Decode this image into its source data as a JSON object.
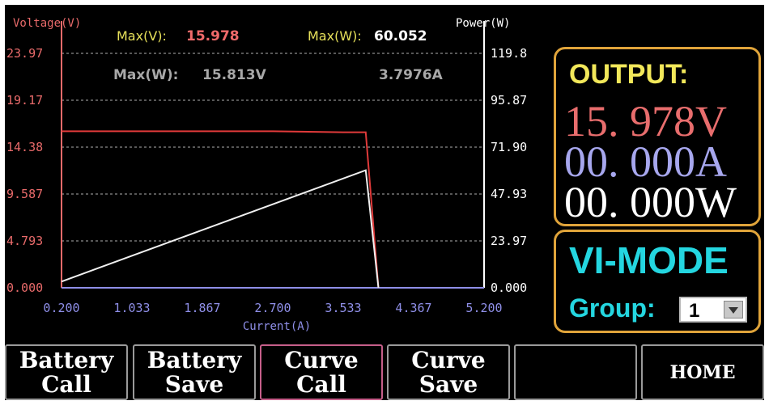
{
  "chart_data": {
    "type": "line",
    "y_axis_label": "Voltage(V)",
    "y2_axis_label": "Power(W)",
    "x_axis_label": "Current(A)",
    "xlim": [
      0.2,
      5.2
    ],
    "ylim": [
      0,
      23.97
    ],
    "y2lim": [
      0,
      119.8
    ],
    "x_ticks": [
      "0.200",
      "1.033",
      "1.867",
      "2.700",
      "3.533",
      "4.367",
      "5.200"
    ],
    "y_ticks": [
      "0.000",
      "4.793",
      "9.587",
      "14.38",
      "19.17",
      "23.97"
    ],
    "y2_ticks": [
      "0.000",
      "23.97",
      "47.93",
      "71.90",
      "95.87",
      "119.8"
    ],
    "max_v_label": "Max(V):",
    "max_v_value": "15.978",
    "max_w_label": "Max(W):",
    "max_w_value": "60.052",
    "maxw_point_label": "Max(W):",
    "maxw_point_voltage": "15.813V",
    "maxw_point_current": "3.7976A",
    "series": [
      {
        "axis": "left",
        "color": "#e03a3a",
        "points": [
          [
            0.2,
            16.0
          ],
          [
            2.7,
            16.0
          ],
          [
            3.533,
            15.9
          ],
          [
            3.8,
            15.9
          ],
          [
            3.95,
            0.0
          ]
        ]
      },
      {
        "axis": "right",
        "color": "#f0f0f0",
        "points": [
          [
            0.2,
            3.2
          ],
          [
            3.8,
            60.052
          ],
          [
            3.95,
            0.0
          ]
        ]
      }
    ],
    "colors": {
      "voltage_axis": "#e86a6a",
      "power_axis": "#ffffff",
      "current_axis": "#8f8fe8",
      "grid": "#b0b0b0",
      "max_label": "#e6e05a",
      "max_v_value": "#f06a6a",
      "max_w_value": "#ffffff",
      "info": "#a8a8a8"
    }
  },
  "output": {
    "title": "OUTPUT:",
    "voltage": "15. 978V",
    "current": "00. 000A",
    "power": "00. 000W",
    "colors": {
      "voltage": "#e86d6d",
      "current": "#a7a7ee",
      "power": "#ffffff"
    }
  },
  "mode": {
    "title": "VI-MODE",
    "group_label": "Group:",
    "group_value": "1"
  },
  "buttons": [
    {
      "label": "Battery\nCall",
      "name": "battery-call-button",
      "active": false
    },
    {
      "label": "Battery\nSave",
      "name": "battery-save-button",
      "active": false
    },
    {
      "label": "Curve\nCall",
      "name": "curve-call-button",
      "active": true
    },
    {
      "label": "Curve\nSave",
      "name": "curve-save-button",
      "active": false
    },
    {
      "label": "",
      "name": "blank-button",
      "active": false
    },
    {
      "label": "HOME",
      "name": "home-button",
      "active": false
    }
  ]
}
